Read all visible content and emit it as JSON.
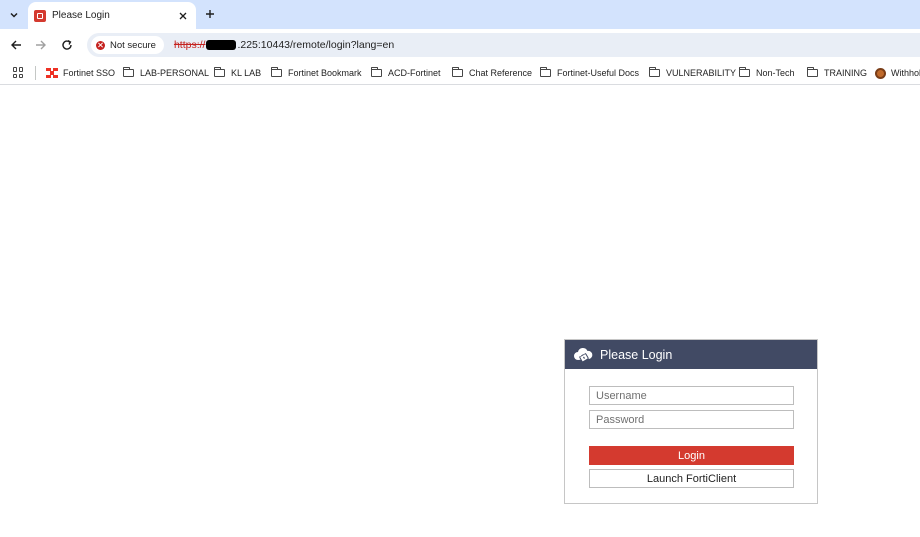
{
  "tab": {
    "title": "Please Login"
  },
  "toolbar": {
    "security_label": "Not secure",
    "url_scheme": "https://",
    "url_rest": ".225:10443/remote/login?lang=en"
  },
  "bookmarks": [
    {
      "label": "Fortinet SSO",
      "icon": "fortinet-logo"
    },
    {
      "label": "LAB-PERSONAL",
      "icon": "folder-icon"
    },
    {
      "label": "KL LAB",
      "icon": "folder-icon"
    },
    {
      "label": "Fortinet Bookmark",
      "icon": "folder-icon"
    },
    {
      "label": "ACD-Fortinet",
      "icon": "folder-icon"
    },
    {
      "label": "Chat Reference",
      "icon": "folder-icon"
    },
    {
      "label": "Fortinet-Useful Docs",
      "icon": "folder-icon"
    },
    {
      "label": "VULNERABILITY",
      "icon": "folder-icon"
    },
    {
      "label": "Non-Tech",
      "icon": "folder-icon"
    },
    {
      "label": "TRAINING",
      "icon": "folder-icon"
    },
    {
      "label": "Withhol",
      "icon": "globe-icon"
    }
  ],
  "login": {
    "title": "Please Login",
    "username_placeholder": "Username",
    "password_placeholder": "Password",
    "login_label": "Login",
    "forticlient_label": "Launch FortiClient"
  },
  "colors": {
    "header_bg": "#414a64",
    "login_button": "#d43a2f",
    "tabstrip": "#d3e3fd"
  }
}
